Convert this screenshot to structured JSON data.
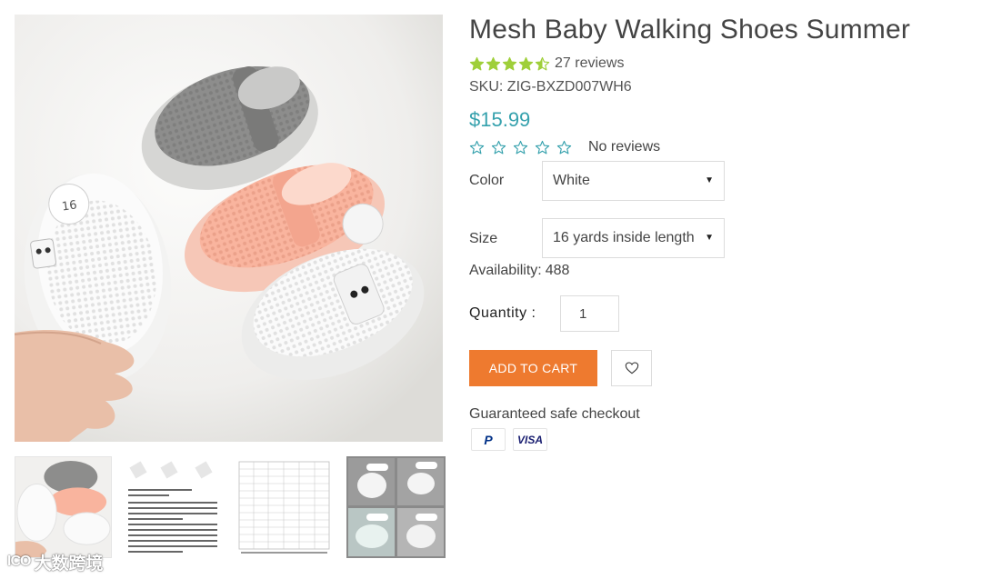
{
  "product": {
    "title": "Mesh Baby Walking Shoes Summer",
    "rating_value": 4.5,
    "reviews_label": "27 reviews",
    "sku_label": "SKU: ZIG-BXZD007WH6",
    "price": "$15.99",
    "review_summary": {
      "stars_filled": 0,
      "stars_total": 5,
      "label": "No reviews"
    }
  },
  "options": {
    "color": {
      "label": "Color",
      "value": "White"
    },
    "size": {
      "label": "Size",
      "value": "16 yards inside length"
    }
  },
  "availability": {
    "label": "Availability:",
    "count": "488"
  },
  "quantity": {
    "label": "Quantity :",
    "value": "1"
  },
  "actions": {
    "add_to_cart": "ADD TO CART",
    "wishlist_icon": "heart-outline-icon"
  },
  "checkout": {
    "guarantee": "Guaranteed safe checkout",
    "payment_methods": [
      "PayPal",
      "VISA"
    ]
  },
  "gallery": {
    "thumbnail_count": 4
  },
  "watermark": {
    "logo": "ICO",
    "text": "大数跨境"
  },
  "colors": {
    "accent_price": "#35a1ad",
    "star_filled": "#9fcf3a",
    "star_outline": "#35a1ad",
    "add_to_cart_bg": "#ee7a2f"
  }
}
